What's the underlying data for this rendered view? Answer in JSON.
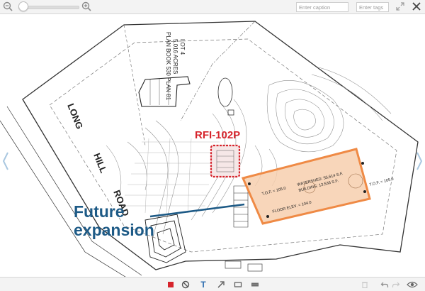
{
  "toolbar": {
    "caption_placeholder": "Enter caption",
    "tags_placeholder": "Enter tags",
    "zoom_level": 0.0
  },
  "drawing": {
    "road_words": [
      "LONG",
      "HILL",
      "ROAD"
    ],
    "rfi_label": "RFI-102P",
    "callout_line1": "Future",
    "callout_line2": "expansion",
    "lot_lines": [
      "LOT 4",
      "5,016 ACRES",
      "PLAN BOOK 530 PLAN 81"
    ],
    "pad_watershed": "WATERSHED: 55,614 S.F.",
    "pad_building": "BUILDING: 13,536 S.F.",
    "pad_tof_left": "T.O.F. = 105.0",
    "pad_floor": "FLOOR ELEV. = 104.0",
    "pad_tof_right": "T.O.F. = 105.0",
    "colors": {
      "rfi": "#d6242c",
      "callout": "#1d5a86",
      "building_outline": "#ef8a45",
      "building_fill": "#f7cfae"
    }
  },
  "icons": {
    "zoom_out": "zoom-out-icon",
    "zoom_in": "zoom-in-icon",
    "expand": "expand-icon",
    "close": "close-icon",
    "prev": "chevron-left-icon",
    "next": "chevron-right-icon",
    "tools": [
      "square-tool-icon",
      "no-entry-tool-icon",
      "text-tool-icon",
      "arrow-tool-icon",
      "rectangle-tool-icon",
      "redact-tool-icon"
    ],
    "actions": [
      "trash-icon",
      "undo-icon",
      "redo-icon",
      "eye-icon"
    ]
  },
  "text_tool_glyph": "T"
}
